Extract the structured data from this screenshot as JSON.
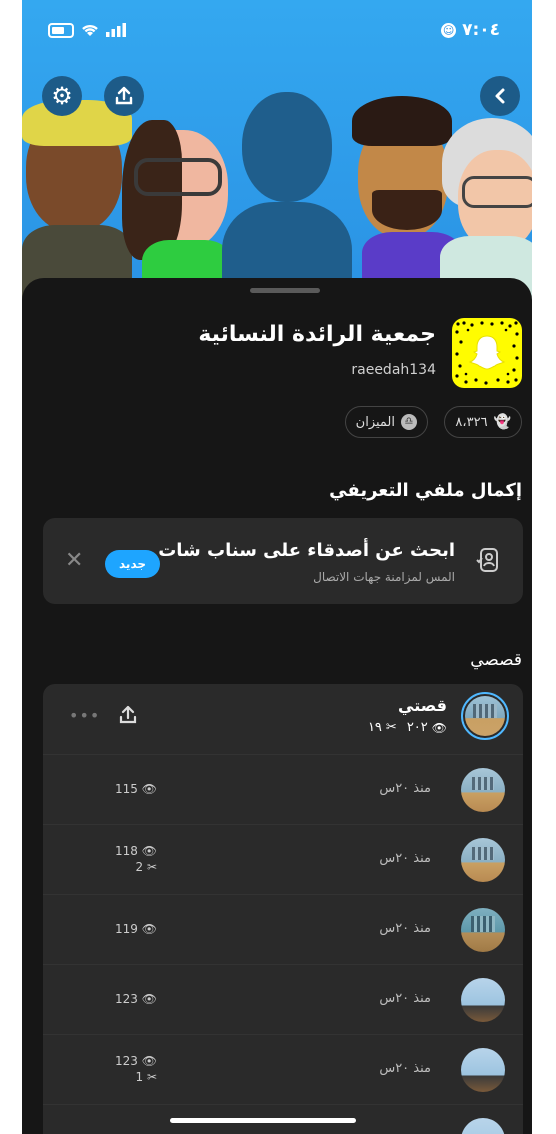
{
  "status_bar": {
    "time": "٧:٠٤"
  },
  "profile": {
    "display_name": "جمعية الرائدة النسائية",
    "username": "raeedah134",
    "score": "٨،٣٢٦",
    "zodiac": "الميزان"
  },
  "complete_profile": {
    "heading": "إكمال ملفي التعريفي",
    "card_title": "ابحث عن أصدقاء على سناب شات",
    "card_subtitle": "المس لمزامنة جهات الاتصال",
    "badge": "جديد"
  },
  "stories": {
    "heading": "قصصي",
    "my_story": {
      "title": "قصتي",
      "views": "٢٠٢",
      "shares": "١٩"
    },
    "items": [
      {
        "time": "منذ ٢٠س",
        "views": "115",
        "shares": ""
      },
      {
        "time": "منذ ٢٠س",
        "views": "118",
        "shares": "2"
      },
      {
        "time": "منذ ٢٠س",
        "views": "119",
        "shares": ""
      },
      {
        "time": "منذ ٢٠س",
        "views": "123",
        "shares": ""
      },
      {
        "time": "منذ ٢٠س",
        "views": "123",
        "shares": "1"
      }
    ]
  },
  "colors": {
    "header": "#2a92e4",
    "accent": "#1ea5ff",
    "snapcode": "#fffc00",
    "sheet": "#161616"
  }
}
